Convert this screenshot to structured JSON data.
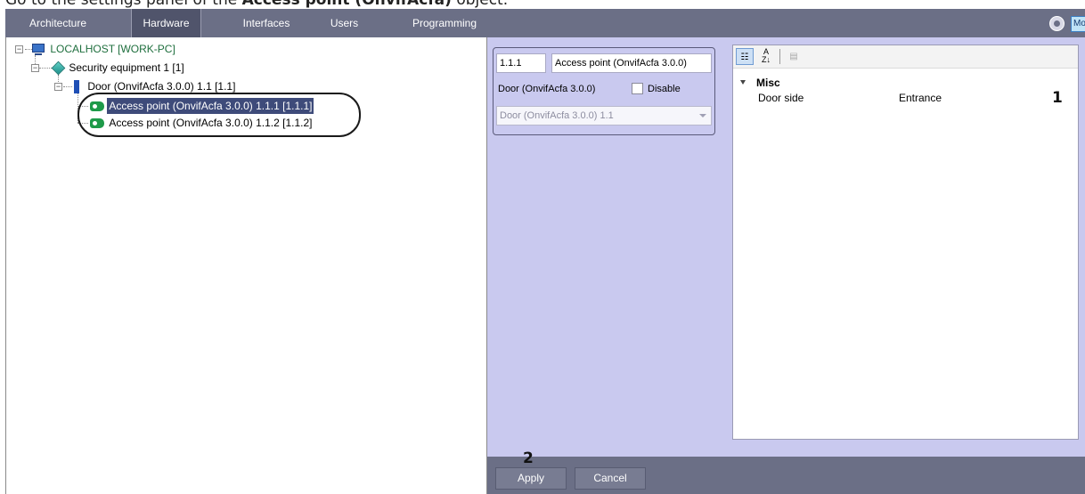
{
  "caption": {
    "prefix": "Go to the settings panel of the ",
    "bold": "Access point (OnvifAcfa)",
    "suffix": " object."
  },
  "tabs": [
    {
      "label": "Architecture"
    },
    {
      "label": "Hardware"
    },
    {
      "label": "Interfaces"
    },
    {
      "label": "Users"
    },
    {
      "label": "Programming"
    }
  ],
  "active_tab": "Hardware",
  "top_right": {
    "button_label": "Mo"
  },
  "tree": [
    {
      "label": "LOCALHOST [WORK-PC]",
      "icon": "computer-icon"
    },
    {
      "label": "Security equipment 1 [1]",
      "icon": "cube-icon"
    },
    {
      "label": "Door (OnvifAcfa 3.0.0) 1.1 [1.1]",
      "icon": "door-icon"
    },
    {
      "label": "Access point (OnvifAcfa 3.0.0) 1.1.1 [1.1.1]",
      "icon": "access-point-icon",
      "selected": true
    },
    {
      "label": "Access point (OnvifAcfa 3.0.0) 1.1.2 [1.1.2]",
      "icon": "access-point-icon"
    }
  ],
  "settings": {
    "id": "1.1.1",
    "name": "Access point (OnvifAcfa 3.0.0)",
    "parent_label": "Door (OnvifAcfa 3.0.0)",
    "disable_label": "Disable",
    "disable_checked": false,
    "parent_select": "Door (OnvifAcfa 3.0.0) 1.1"
  },
  "properties": {
    "category": "Misc",
    "rows": [
      {
        "name": "Door side",
        "value": "Entrance"
      }
    ]
  },
  "buttons": {
    "apply": "Apply",
    "cancel": "Cancel"
  },
  "callouts": [
    "1",
    "2"
  ],
  "colors": {
    "tab_bar": "#6b6f86",
    "panel": "#c9c9ef",
    "selection": "#3e4b7a",
    "tree_text": "#1f6f3e"
  }
}
